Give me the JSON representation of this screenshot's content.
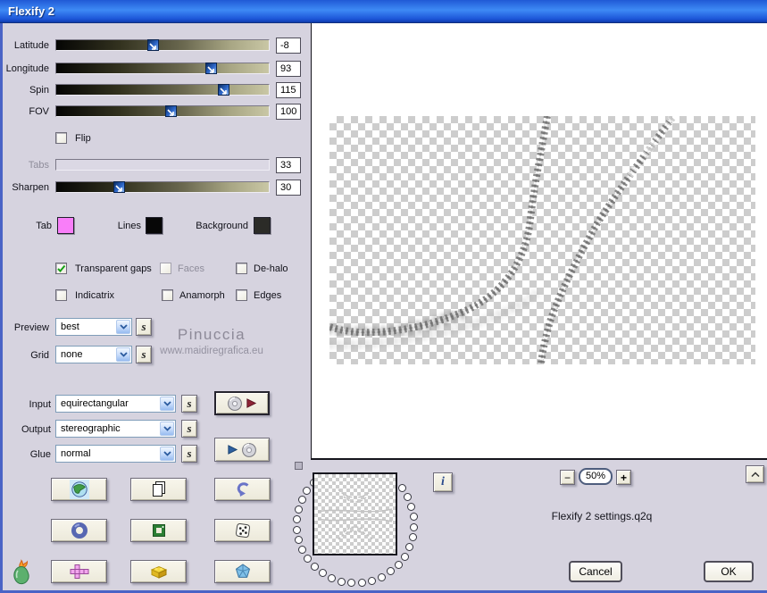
{
  "window": {
    "title": "Flexify 2"
  },
  "sliders": {
    "latitude": {
      "label": "Latitude",
      "value": "-8"
    },
    "longitude": {
      "label": "Longitude",
      "value": "93"
    },
    "spin": {
      "label": "Spin",
      "value": "115"
    },
    "fov": {
      "label": "FOV",
      "value": "100"
    },
    "tabs": {
      "label": "Tabs",
      "value": "33",
      "disabled": true
    },
    "sharpen": {
      "label": "Sharpen",
      "value": "30"
    }
  },
  "flip": {
    "label": "Flip",
    "checked": false
  },
  "swatches": {
    "tab": {
      "label": "Tab",
      "color": "#f97ef9"
    },
    "lines": {
      "label": "Lines",
      "color": "#070707"
    },
    "background": {
      "label": "Background",
      "color": "#2b2b27"
    }
  },
  "checkboxes": {
    "transparent_gaps": {
      "label": "Transparent gaps",
      "checked": true
    },
    "faces": {
      "label": "Faces",
      "checked": false,
      "disabled": true
    },
    "dehalo": {
      "label": "De-halo",
      "checked": false
    },
    "indicatrix": {
      "label": "Indicatrix",
      "checked": false
    },
    "anamorph": {
      "label": "Anamorph",
      "checked": false
    },
    "edges": {
      "label": "Edges",
      "checked": false
    }
  },
  "combos": {
    "preview": {
      "label": "Preview",
      "value": "best"
    },
    "grid": {
      "label": "Grid",
      "value": "none"
    },
    "input": {
      "label": "Input",
      "value": "equirectangular"
    },
    "output": {
      "label": "Output",
      "value": "stereographic"
    },
    "glue": {
      "label": "Glue",
      "value": "normal"
    }
  },
  "s_button_label": "s",
  "watermark": {
    "line1": "Pinuccia",
    "line2": "www.maidiregrafica.eu"
  },
  "zoom_bar": {
    "zoom_out": "−",
    "level": "50%",
    "zoom_in": "+"
  },
  "info_button_label": "i",
  "settings_file": "Flexify 2 settings.q2q",
  "actions": {
    "cancel": "Cancel",
    "ok": "OK"
  },
  "icon_buttons": [
    "globe",
    "copy",
    "undo",
    "ring",
    "frame",
    "dice",
    "cube-net",
    "brick",
    "polyhedron"
  ],
  "accent_colors": {
    "titlebar_blue": "#2059d6",
    "dialog_bg": "#d6d3df",
    "button_face": "#f0edde"
  }
}
